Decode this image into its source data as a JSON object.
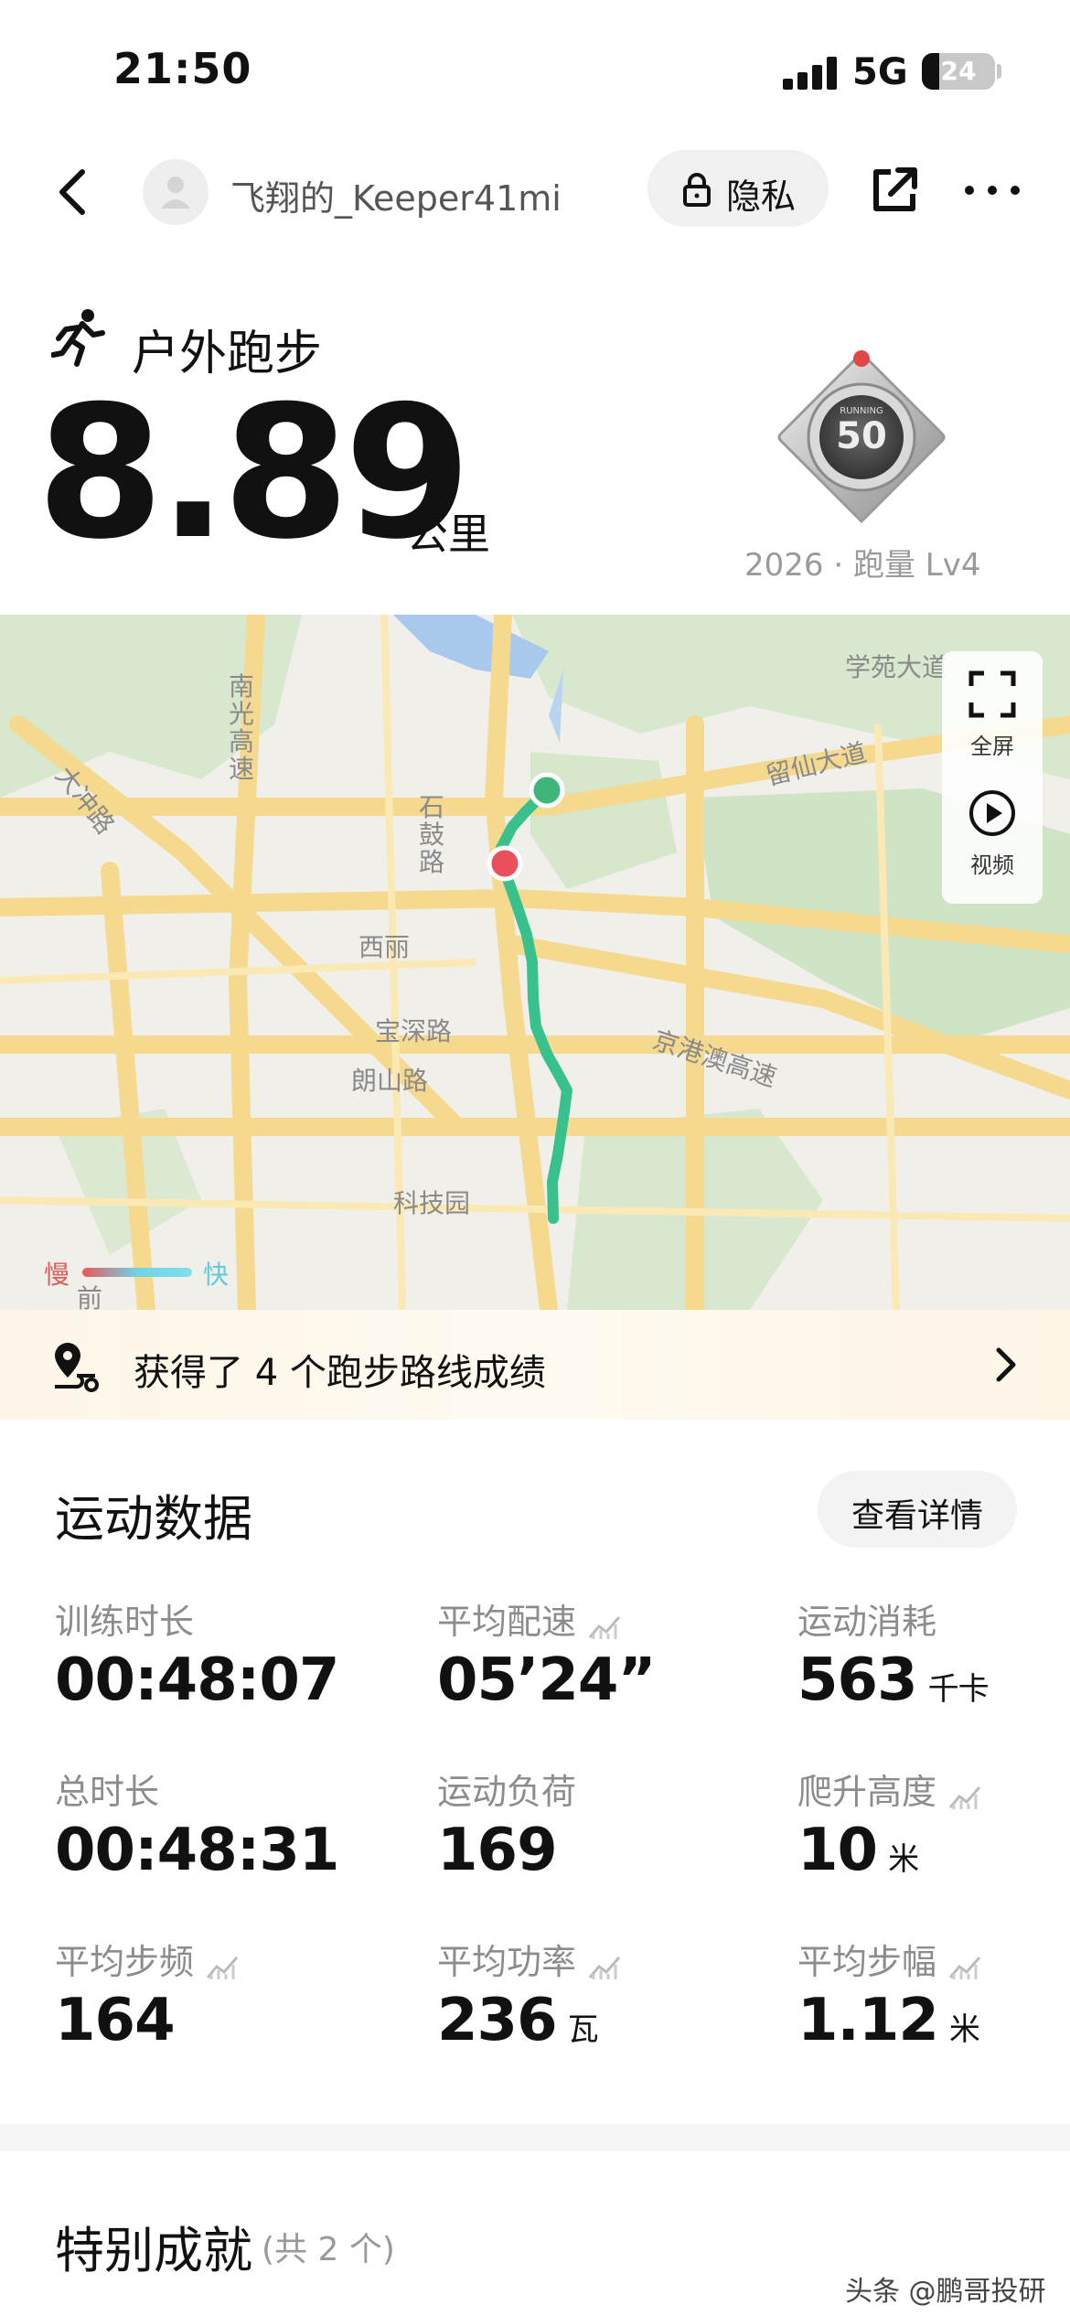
{
  "status_bar": {
    "time": "21:50",
    "network": "5G",
    "battery": "24"
  },
  "nav": {
    "username": "飞翔的_Keeper41mi",
    "privacy_label": "隐私"
  },
  "summary": {
    "sport_type": "户外跑步",
    "distance": "8.89",
    "distance_unit": "公里",
    "badge_caption": "2026 · 跑量 Lv4",
    "badge_number": "50"
  },
  "map": {
    "labels": {
      "xueyuan": "学苑大道",
      "liuxian": "留仙大道",
      "nanguang": "南光高速",
      "shigu": "石鼓路",
      "dachong": "大冲路",
      "xili": "西丽",
      "baoshen": "宝深路",
      "langshan": "朗山路",
      "jinggang": "京港澳高速",
      "keji": "科技园",
      "qian": "前"
    },
    "fullscreen_label": "全屏",
    "video_label": "视频",
    "legend_slow": "慢",
    "legend_fast": "快"
  },
  "banner": {
    "text": "获得了 4 个跑步路线成绩"
  },
  "sport_data": {
    "title": "运动数据",
    "detail_button": "查看详情",
    "metrics": [
      {
        "label": "训练时长",
        "value": "00:48:07",
        "unit": ""
      },
      {
        "label": "平均配速",
        "value": "05’24”",
        "unit": ""
      },
      {
        "label": "运动消耗",
        "value": "563",
        "unit": "千卡"
      },
      {
        "label": "总时长",
        "value": "00:48:31",
        "unit": ""
      },
      {
        "label": "运动负荷",
        "value": "169",
        "unit": ""
      },
      {
        "label": "爬升高度",
        "value": "10",
        "unit": "米"
      },
      {
        "label": "平均步频",
        "value": "164",
        "unit": ""
      },
      {
        "label": "平均功率",
        "value": "236",
        "unit": "瓦"
      },
      {
        "label": "平均步幅",
        "value": "1.12",
        "unit": "米"
      }
    ]
  },
  "special": {
    "title": "特别成就",
    "count": "(共 2 个)"
  },
  "watermark": "头条 @鹏哥投研"
}
